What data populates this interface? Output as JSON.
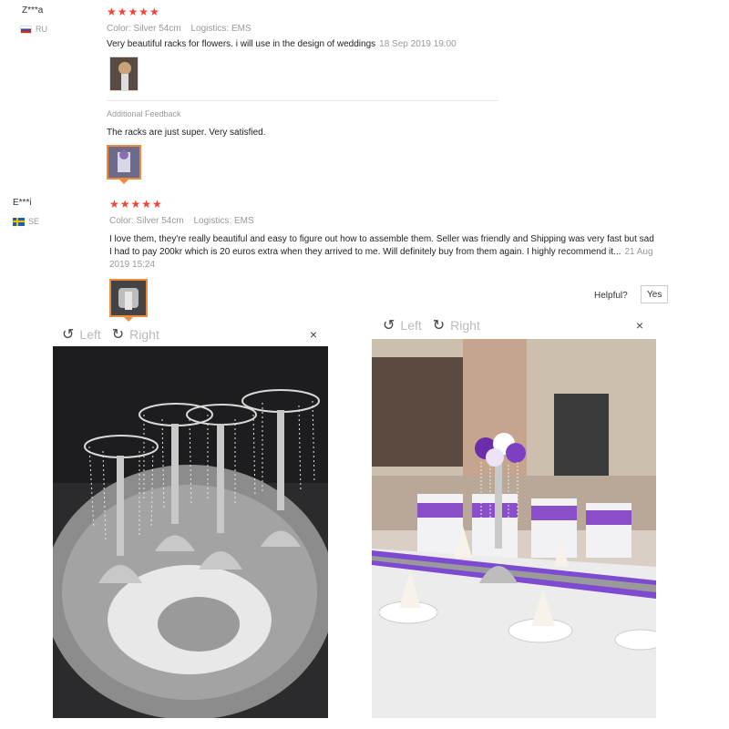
{
  "reviews": [
    {
      "user": "Z***a",
      "country": "RU",
      "stars": "★★★★★",
      "color": "Color: Silver 54cm",
      "logistics": "Logistics: EMS",
      "text": "Very beautiful racks for flowers. i will use in the design of weddings",
      "date": "18 Sep 2019 19:00",
      "additional_label": "Additional Feedback",
      "additional_text": "The racks are just super. Very satisfied."
    },
    {
      "user": "E***i",
      "country": "SE",
      "stars": "★★★★★",
      "color": "Color: Silver 54cm",
      "logistics": "Logistics: EMS",
      "text": "I love them, they're really beautiful and easy to figure out how to assemble them. Seller was friendly and Shipping was very fast but sad I had to pay 200kr which is 20 euros extra when they arrived to me. Will definitely buy from them again. I highly recommend it...",
      "date": "21 Aug 2019 15:24",
      "helpful_label": "Helpful?",
      "yes_label": "Yes"
    }
  ],
  "viewers": [
    {
      "left_label": "Left",
      "right_label": "Right",
      "close": "×"
    },
    {
      "left_label": "Left",
      "right_label": "Right",
      "close": "×"
    }
  ],
  "icons": {
    "rotate_left": "rotate-left-icon",
    "rotate_right": "rotate-right-icon",
    "close": "close-icon"
  }
}
